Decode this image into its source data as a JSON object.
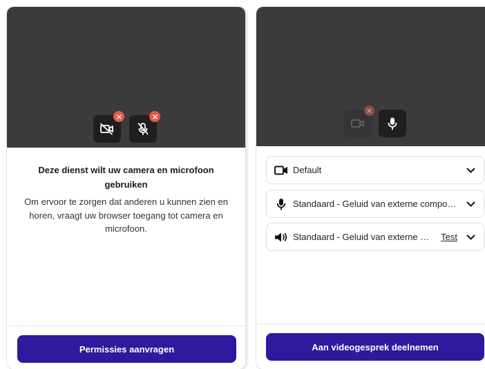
{
  "permissions_panel": {
    "title": "Deze dienst wilt uw camera en microfoon gebruiken",
    "description": "Om ervoor te zorgen dat anderen u kunnen zien en horen, vraagt uw browser toegang tot camera en microfoon.",
    "button_label": "Permissies aanvragen",
    "controls": [
      {
        "icon": "camera-off-icon",
        "status": "blocked"
      },
      {
        "icon": "microphone-off-icon",
        "status": "blocked"
      }
    ]
  },
  "setup_panel": {
    "controls": [
      {
        "icon": "camera-icon",
        "status": "disabled"
      },
      {
        "icon": "microphone-icon",
        "status": "on"
      }
    ],
    "devices": [
      {
        "type": "camera",
        "icon": "camera-icon",
        "label": "Default"
      },
      {
        "type": "microphone",
        "icon": "microphone-icon",
        "label": "Standaard - Geluid van externe componenten"
      },
      {
        "type": "speaker",
        "icon": "speaker-icon",
        "label": "Standaard - Geluid van externe componenten",
        "test_label": "Test"
      }
    ],
    "button_label": "Aan videogesprek deelnemen"
  },
  "colors": {
    "primary": "#2d1a9c",
    "preview_bg": "#3b3b3b",
    "control_bg": "#1f1f1f",
    "badge": "#e8574a"
  }
}
